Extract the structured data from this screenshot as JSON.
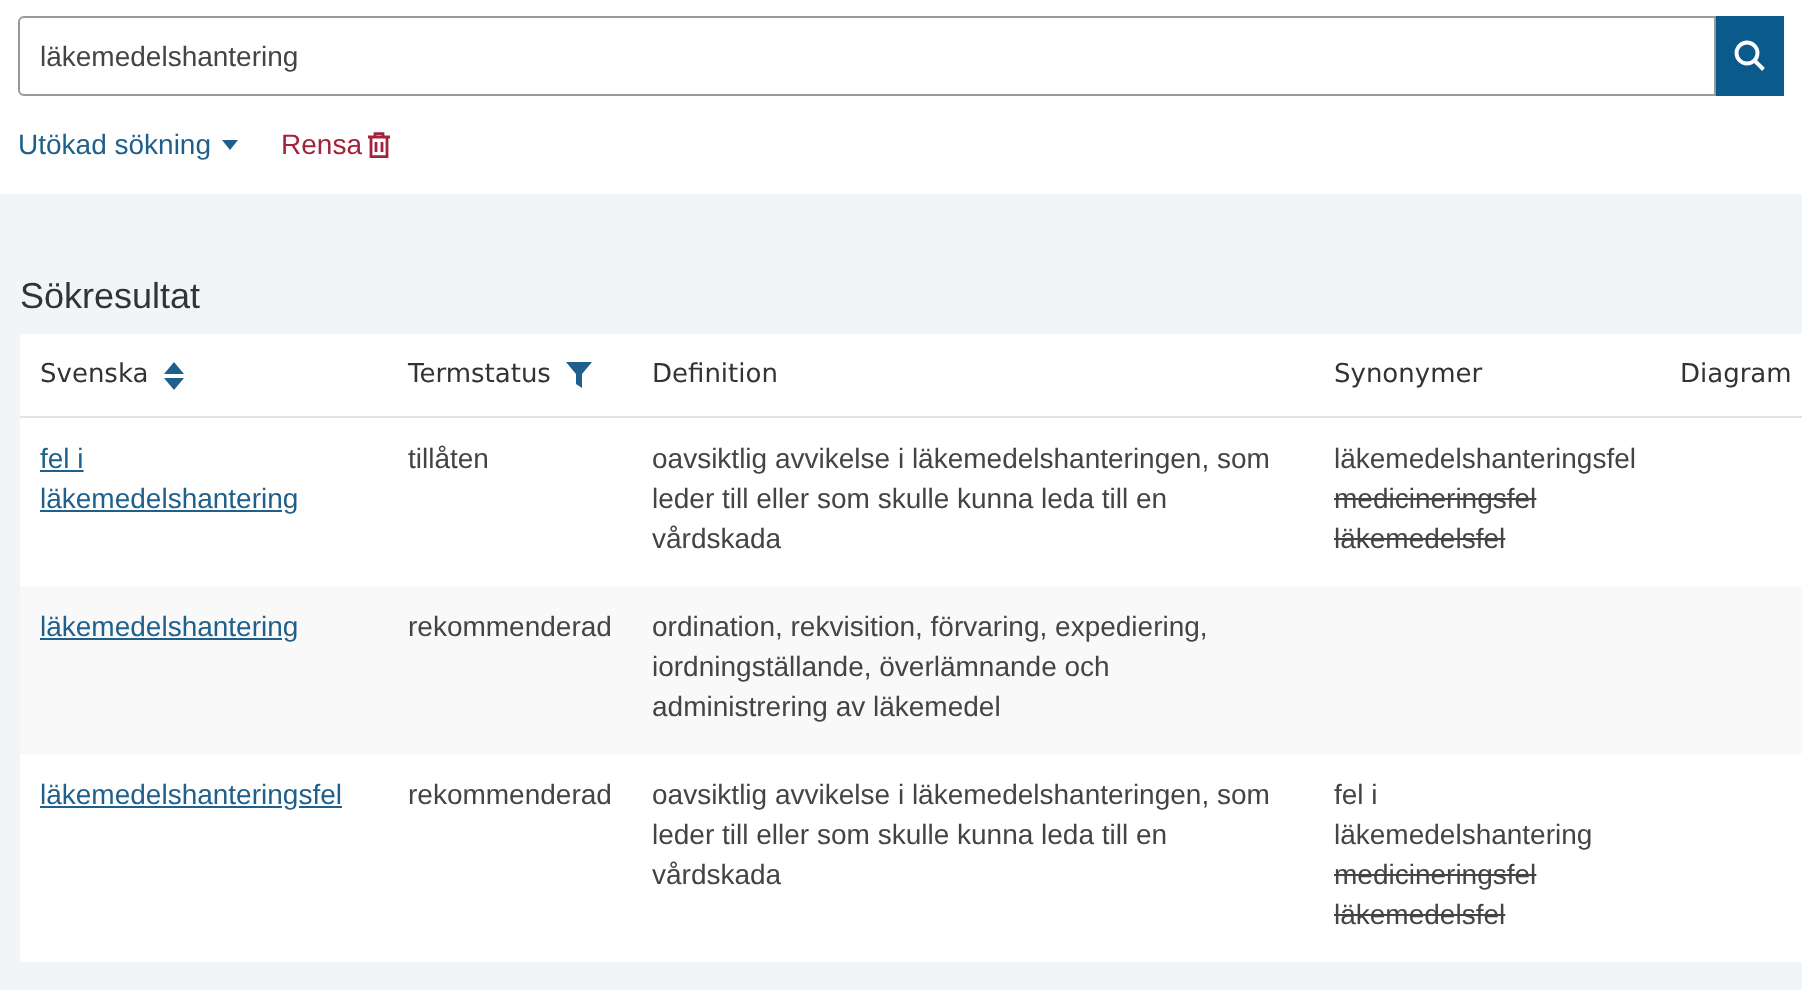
{
  "search": {
    "value": "läkemedelshantering"
  },
  "links": {
    "advanced": "Utökad sökning",
    "clear": "Rensa"
  },
  "results": {
    "title": "Sökresultat",
    "columns": [
      {
        "label": "Svenska",
        "kind": "sort"
      },
      {
        "label": "Termstatus",
        "kind": "filter"
      },
      {
        "label": "Definition",
        "kind": "plain"
      },
      {
        "label": "Synonymer",
        "kind": "plain"
      },
      {
        "label": "Diagram",
        "kind": "plain"
      }
    ],
    "rows": [
      {
        "term": "fel i läkemedelshantering",
        "status": "tillåten",
        "definition": "oavsiktlig avvikelse i läkemedelshanteringen, som leder till eller som skulle kunna leda till en vårdskada",
        "synonyms": [
          {
            "text": "läkemedelshanteringsfel",
            "deprecated": false
          },
          {
            "text": "medicineringsfel",
            "deprecated": true
          },
          {
            "text": "läkemedelsfel",
            "deprecated": true
          }
        ]
      },
      {
        "term": "läkemedelshantering",
        "status": "rekommenderad",
        "definition": "ordination, rekvisition, förvaring, expediering, iordningställande, överlämnande och administrering av läkemedel",
        "synonyms": []
      },
      {
        "term": "läkemedelshanteringsfel",
        "status": "rekommenderad",
        "definition": "oavsiktlig avvikelse i läkemedelshanteringen, som leder till eller som skulle kunna leda till en vårdskada",
        "synonyms": [
          {
            "text": "fel i läkemedelshantering",
            "deprecated": false
          },
          {
            "text": "medicineringsfel",
            "deprecated": true
          },
          {
            "text": "läkemedelsfel",
            "deprecated": true
          }
        ]
      }
    ]
  }
}
